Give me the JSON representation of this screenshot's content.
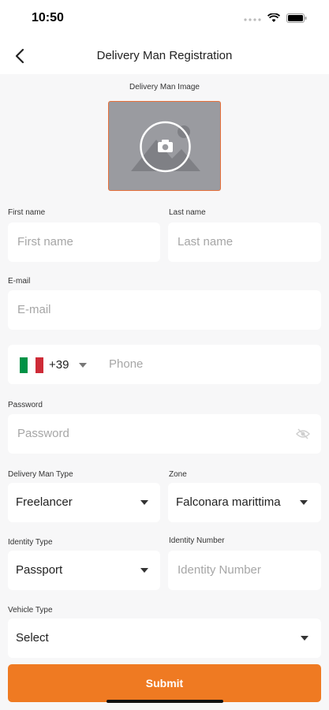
{
  "status_bar": {
    "time": "10:50"
  },
  "app_bar": {
    "title": "Delivery Man Registration"
  },
  "image_section": {
    "label": "Delivery Man Image"
  },
  "form": {
    "first_name": {
      "label": "First name",
      "placeholder": "First name"
    },
    "last_name": {
      "label": "Last name",
      "placeholder": "Last name"
    },
    "email": {
      "label": "E-mail",
      "placeholder": "E-mail"
    },
    "phone": {
      "country_code": "+39",
      "placeholder": "Phone",
      "flag_colors": [
        "#009246",
        "#ffffff",
        "#ce2b37"
      ]
    },
    "password": {
      "label": "Password",
      "placeholder": "Password"
    },
    "delivery_man_type": {
      "label": "Delivery Man Type",
      "value": "Freelancer"
    },
    "zone": {
      "label": "Zone",
      "value": "Falconara marittima"
    },
    "identity_type": {
      "label": "Identity Type",
      "value": "Passport"
    },
    "identity_number": {
      "label": "Identity Number",
      "placeholder": "Identity Number"
    },
    "vehicle_type": {
      "label": "Vehicle Type",
      "value": "Select"
    }
  },
  "submit": {
    "label": "Submit"
  },
  "colors": {
    "accent": "#ef7a22",
    "image_border": "#e8703a",
    "background": "#f7f7f8"
  },
  "icons": [
    "back-arrow-icon",
    "camera-icon",
    "eye-off-icon",
    "chevron-down-icon",
    "wifi-icon",
    "battery-icon",
    "signal-icon"
  ]
}
